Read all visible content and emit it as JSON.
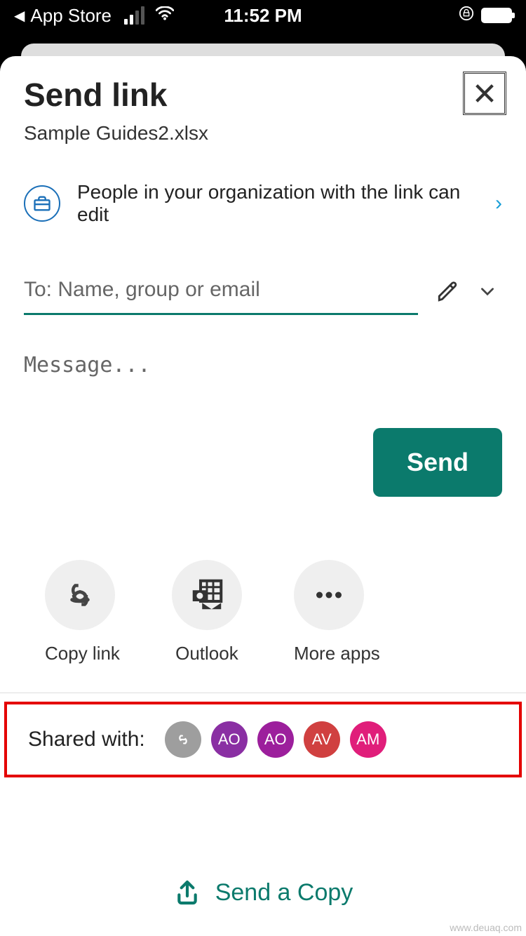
{
  "status": {
    "back_app": "App Store",
    "time": "11:52 PM"
  },
  "dialog": {
    "title": "Send link",
    "filename": "Sample Guides2.xlsx",
    "permission_text": "People in your organization with the link can edit",
    "to_placeholder": "To: Name, group or email",
    "message_placeholder": "Message...",
    "send_label": "Send"
  },
  "share_options": {
    "copy_link": "Copy link",
    "outlook": "Outlook",
    "more_apps": "More apps"
  },
  "shared_with": {
    "label": "Shared with:",
    "avatars": [
      {
        "initials": "",
        "color": "#9e9e9e",
        "is_link": true
      },
      {
        "initials": "AO",
        "color": "#8a2fa3"
      },
      {
        "initials": "AO",
        "color": "#9c1f9c"
      },
      {
        "initials": "AV",
        "color": "#d04040"
      },
      {
        "initials": "AM",
        "color": "#e01e7a"
      }
    ]
  },
  "send_copy_label": "Send a Copy",
  "watermark": "www.deuaq.com"
}
